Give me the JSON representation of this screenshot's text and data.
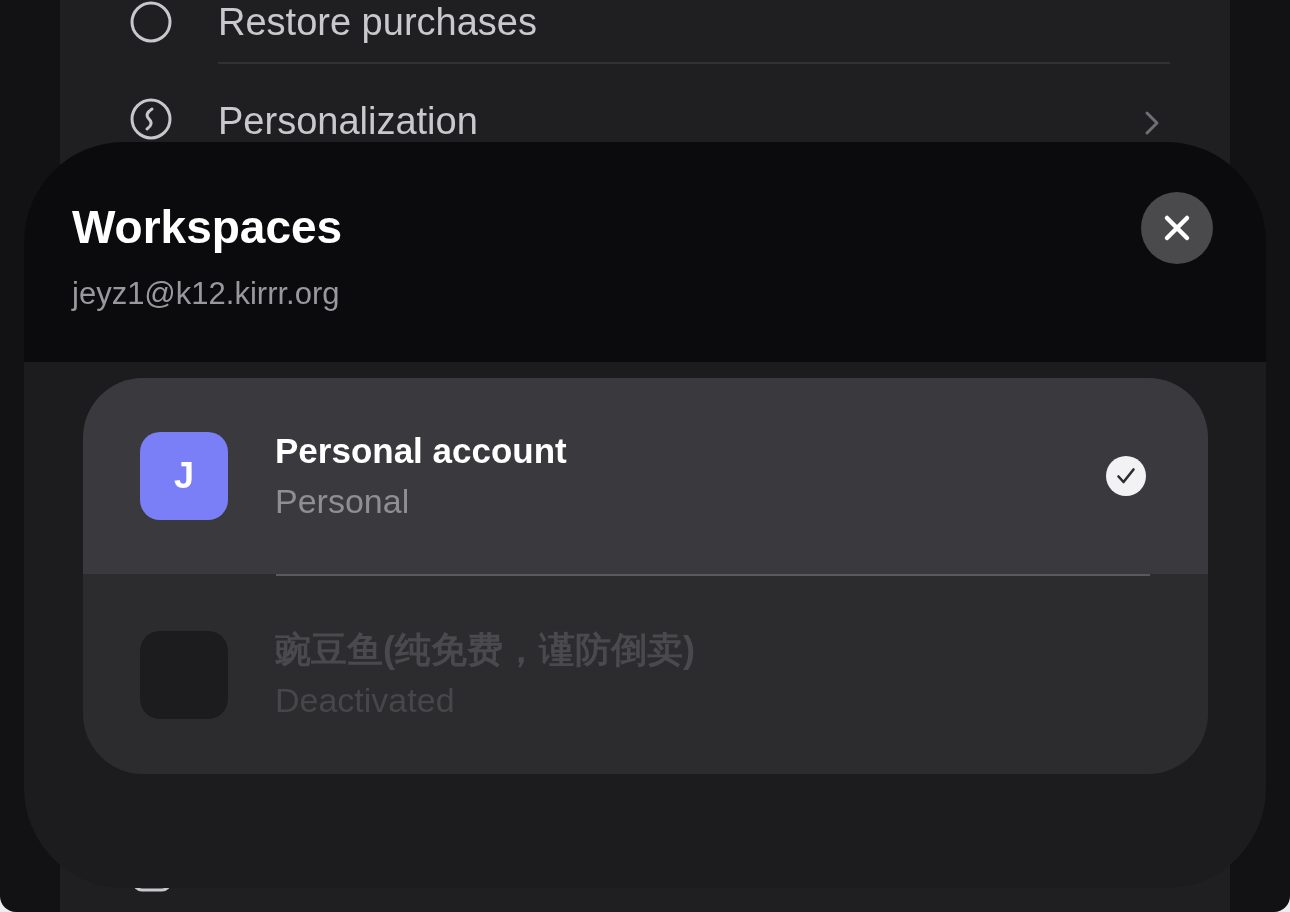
{
  "background_list": {
    "items": [
      {
        "label": "Restore purchases",
        "chevron": false
      },
      {
        "label": "Personalization",
        "chevron": true
      }
    ]
  },
  "sheet": {
    "title": "Workspaces",
    "subtitle": "jeyz1@k12.kirrr.org"
  },
  "workspaces": [
    {
      "name": "Personal account",
      "type": "Personal",
      "initial": "J",
      "color": "#7b7ff7",
      "selected": true,
      "disabled": false
    },
    {
      "name": "豌豆鱼(纯免费，谨防倒卖)",
      "type": "Deactivated",
      "color": "#1c1c1e",
      "selected": false,
      "disabled": true
    }
  ]
}
